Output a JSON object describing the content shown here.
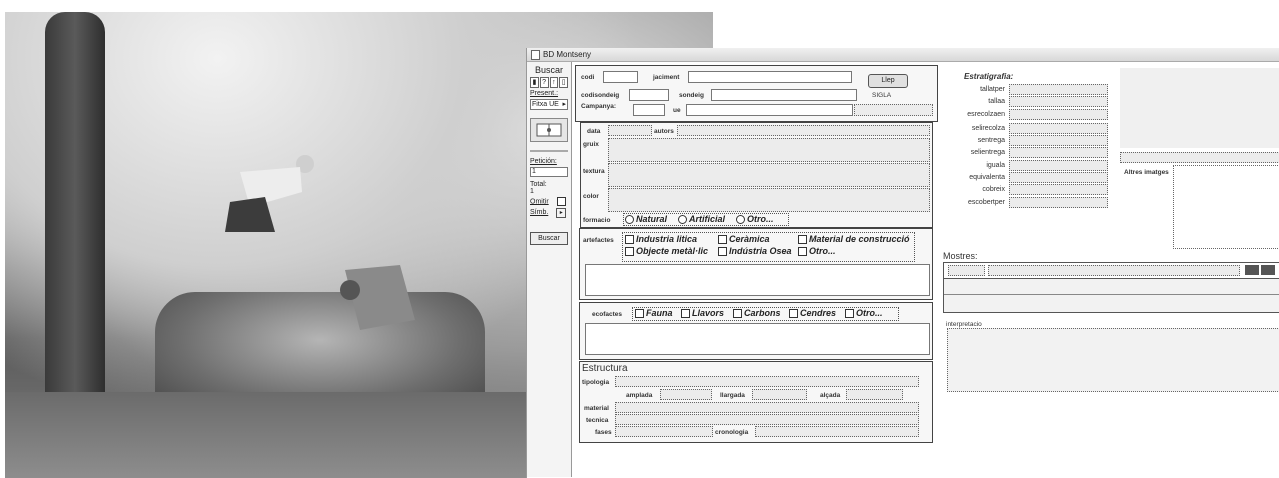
{
  "window": {
    "title": "BD Montseny"
  },
  "sidebar": {
    "search_label": "Buscar",
    "present_label": "Present.:",
    "present_value": "Fitxa UE",
    "peticion_label": "Petición:",
    "peticion_value": "1",
    "total_label": "Total:",
    "total_value": "1",
    "omitir_label": "Omitir",
    "simb_label": "Símb.",
    "buscar_button": "Buscar"
  },
  "header": {
    "codi": "codi",
    "jaciment": "jaciment",
    "llegir_button": "Llep",
    "codisondeig": "codisondeig",
    "sondeig": "sondeig",
    "sigla": "SIGLA",
    "campanya": "Campanya:",
    "ue": "ue"
  },
  "details": {
    "data": "data",
    "autors": "autors",
    "gruix": "gruix",
    "textura": "textura",
    "color": "color",
    "formacio": "formacio",
    "formacio_options": [
      "Natural",
      "Artificial",
      "Otro..."
    ]
  },
  "artefactes": {
    "label": "artefactes",
    "options": [
      "Industria litica",
      "Ceràmica",
      "Material de construcció",
      "Objecte metàl·lic",
      "Indústria Osea",
      "Otro..."
    ]
  },
  "ecofactes": {
    "label": "ecofactes",
    "options": [
      "Fauna",
      "Llavors",
      "Carbons",
      "Cendres",
      "Otro..."
    ]
  },
  "estructura": {
    "title": "Estructura",
    "tipologia": "tipologia",
    "amplada": "amplada",
    "llargada": "llargada",
    "alcada": "alçada",
    "material": "material",
    "tecnica": "tecnica",
    "fases": "fases",
    "cronologia": "cronologia"
  },
  "estratigrafia": {
    "title": "Estratigrafia:",
    "fields": [
      "tallatper",
      "tallaa",
      "esrecolzaen",
      "selirecolza",
      "sentrega",
      "selientrega",
      "iguala",
      "equivalenta",
      "cobreix",
      "escobertper"
    ]
  },
  "images": {
    "altres": "Altres imatges"
  },
  "mostres": {
    "title": "Mostres:"
  },
  "interpretacio": {
    "label": "interpretacio"
  }
}
